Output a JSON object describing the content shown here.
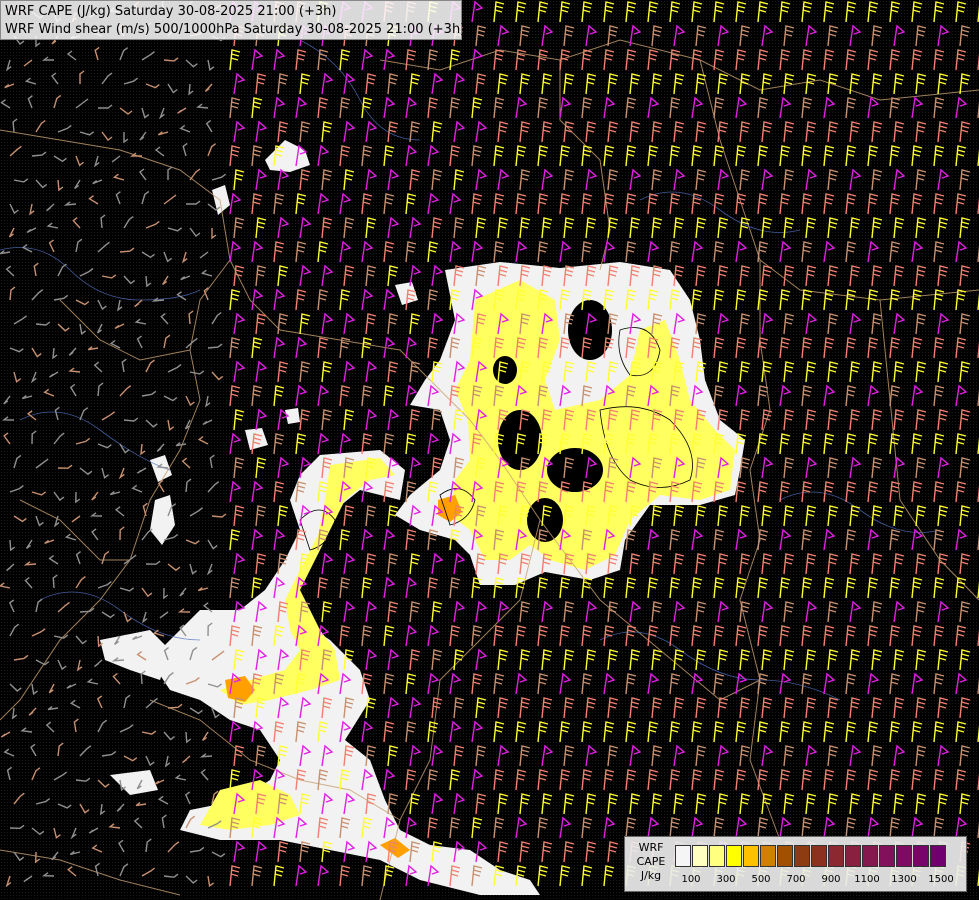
{
  "titles": {
    "line1": "WRF CAPE (J/kg) Saturday 30-08-2025 21:00 (+3h)",
    "line2": "WRF Wind shear (m/s) 500/1000hPa Saturday 30-08-2025 21:00 (+3h)"
  },
  "legend": {
    "label_lines": [
      "WRF",
      "CAPE",
      "J/kg"
    ],
    "swatch_colors": [
      "#f5f5f5",
      "#ffffc0",
      "#ffff80",
      "#ffff00",
      "#ffc000",
      "#d08000",
      "#a05000",
      "#8c3c10",
      "#8c3020",
      "#8c2830",
      "#8a2040",
      "#861850",
      "#82105a",
      "#7e0a64",
      "#78056c",
      "#700070"
    ],
    "tick_labels": [
      "100",
      "300",
      "500",
      "700",
      "900",
      "1100",
      "1300",
      "1500"
    ]
  },
  "colors": {
    "background": "#000000",
    "cape_white": "#f2f2f2",
    "cape_yellow": "#ffff60",
    "cape_orange": "#ffa000",
    "barb_magenta": "#e020e0",
    "barb_yellow": "#ffff30",
    "barb_salmon": "#f08070",
    "barb_tan": "#c89070",
    "barb_gray": "#909090",
    "border_line": "#c8a070",
    "river_line": "#5070c0"
  }
}
